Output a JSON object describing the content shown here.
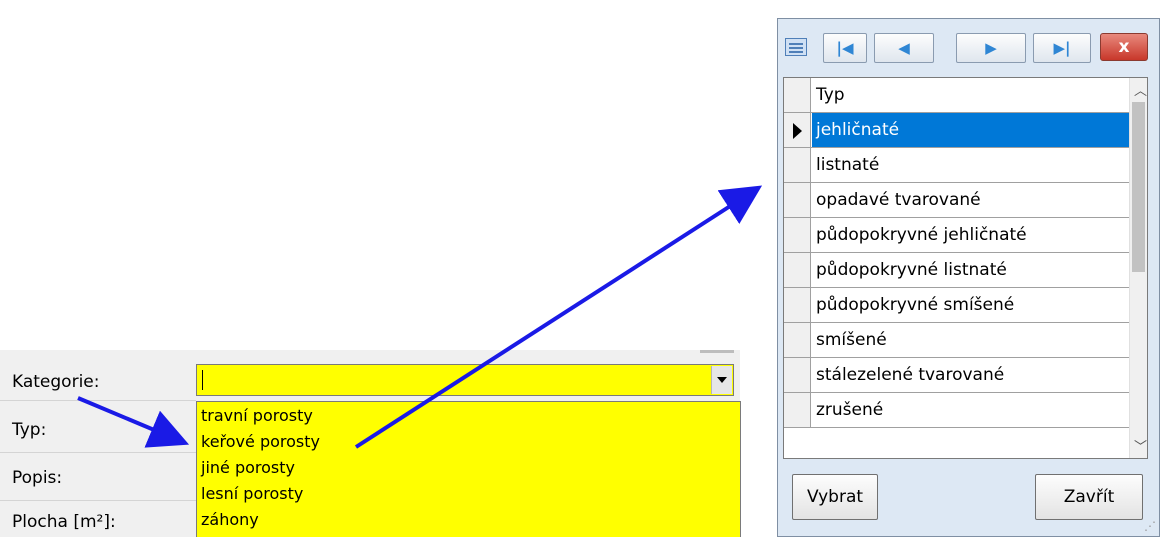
{
  "form": {
    "labels": {
      "kategorie": "Kategorie:",
      "typ": "Typ:",
      "popis": "Popis:",
      "plocha": "Plocha [m²]:"
    },
    "kategorie_value": "",
    "dropdown_items": [
      "travní porosty",
      "keřové porosty",
      "jiné porosty",
      "lesní porosty",
      "záhony"
    ]
  },
  "dialog": {
    "toolbar": {
      "first_icon": "first-record-icon",
      "prev_icon": "previous-record-icon",
      "next_icon": "next-record-icon",
      "last_icon": "last-record-icon",
      "close_icon": "close-icon",
      "close_label": "x"
    },
    "grid": {
      "column_header": "Typ",
      "rows": [
        "jehličnaté",
        "listnaté",
        "opadavé tvarované",
        "půdopokryvné jehličnaté",
        "půdopokryvné listnaté",
        "půdopokryvné smíšené",
        "smíšené",
        "stálezelené tvarované",
        "zrušené"
      ],
      "selected_index": 0
    },
    "buttons": {
      "select_label": "Vybrat",
      "close_label": "Zavřít"
    }
  },
  "colors": {
    "highlight": "#ffff00",
    "selection": "#0078d7",
    "arrow": "#1a1ae6"
  }
}
